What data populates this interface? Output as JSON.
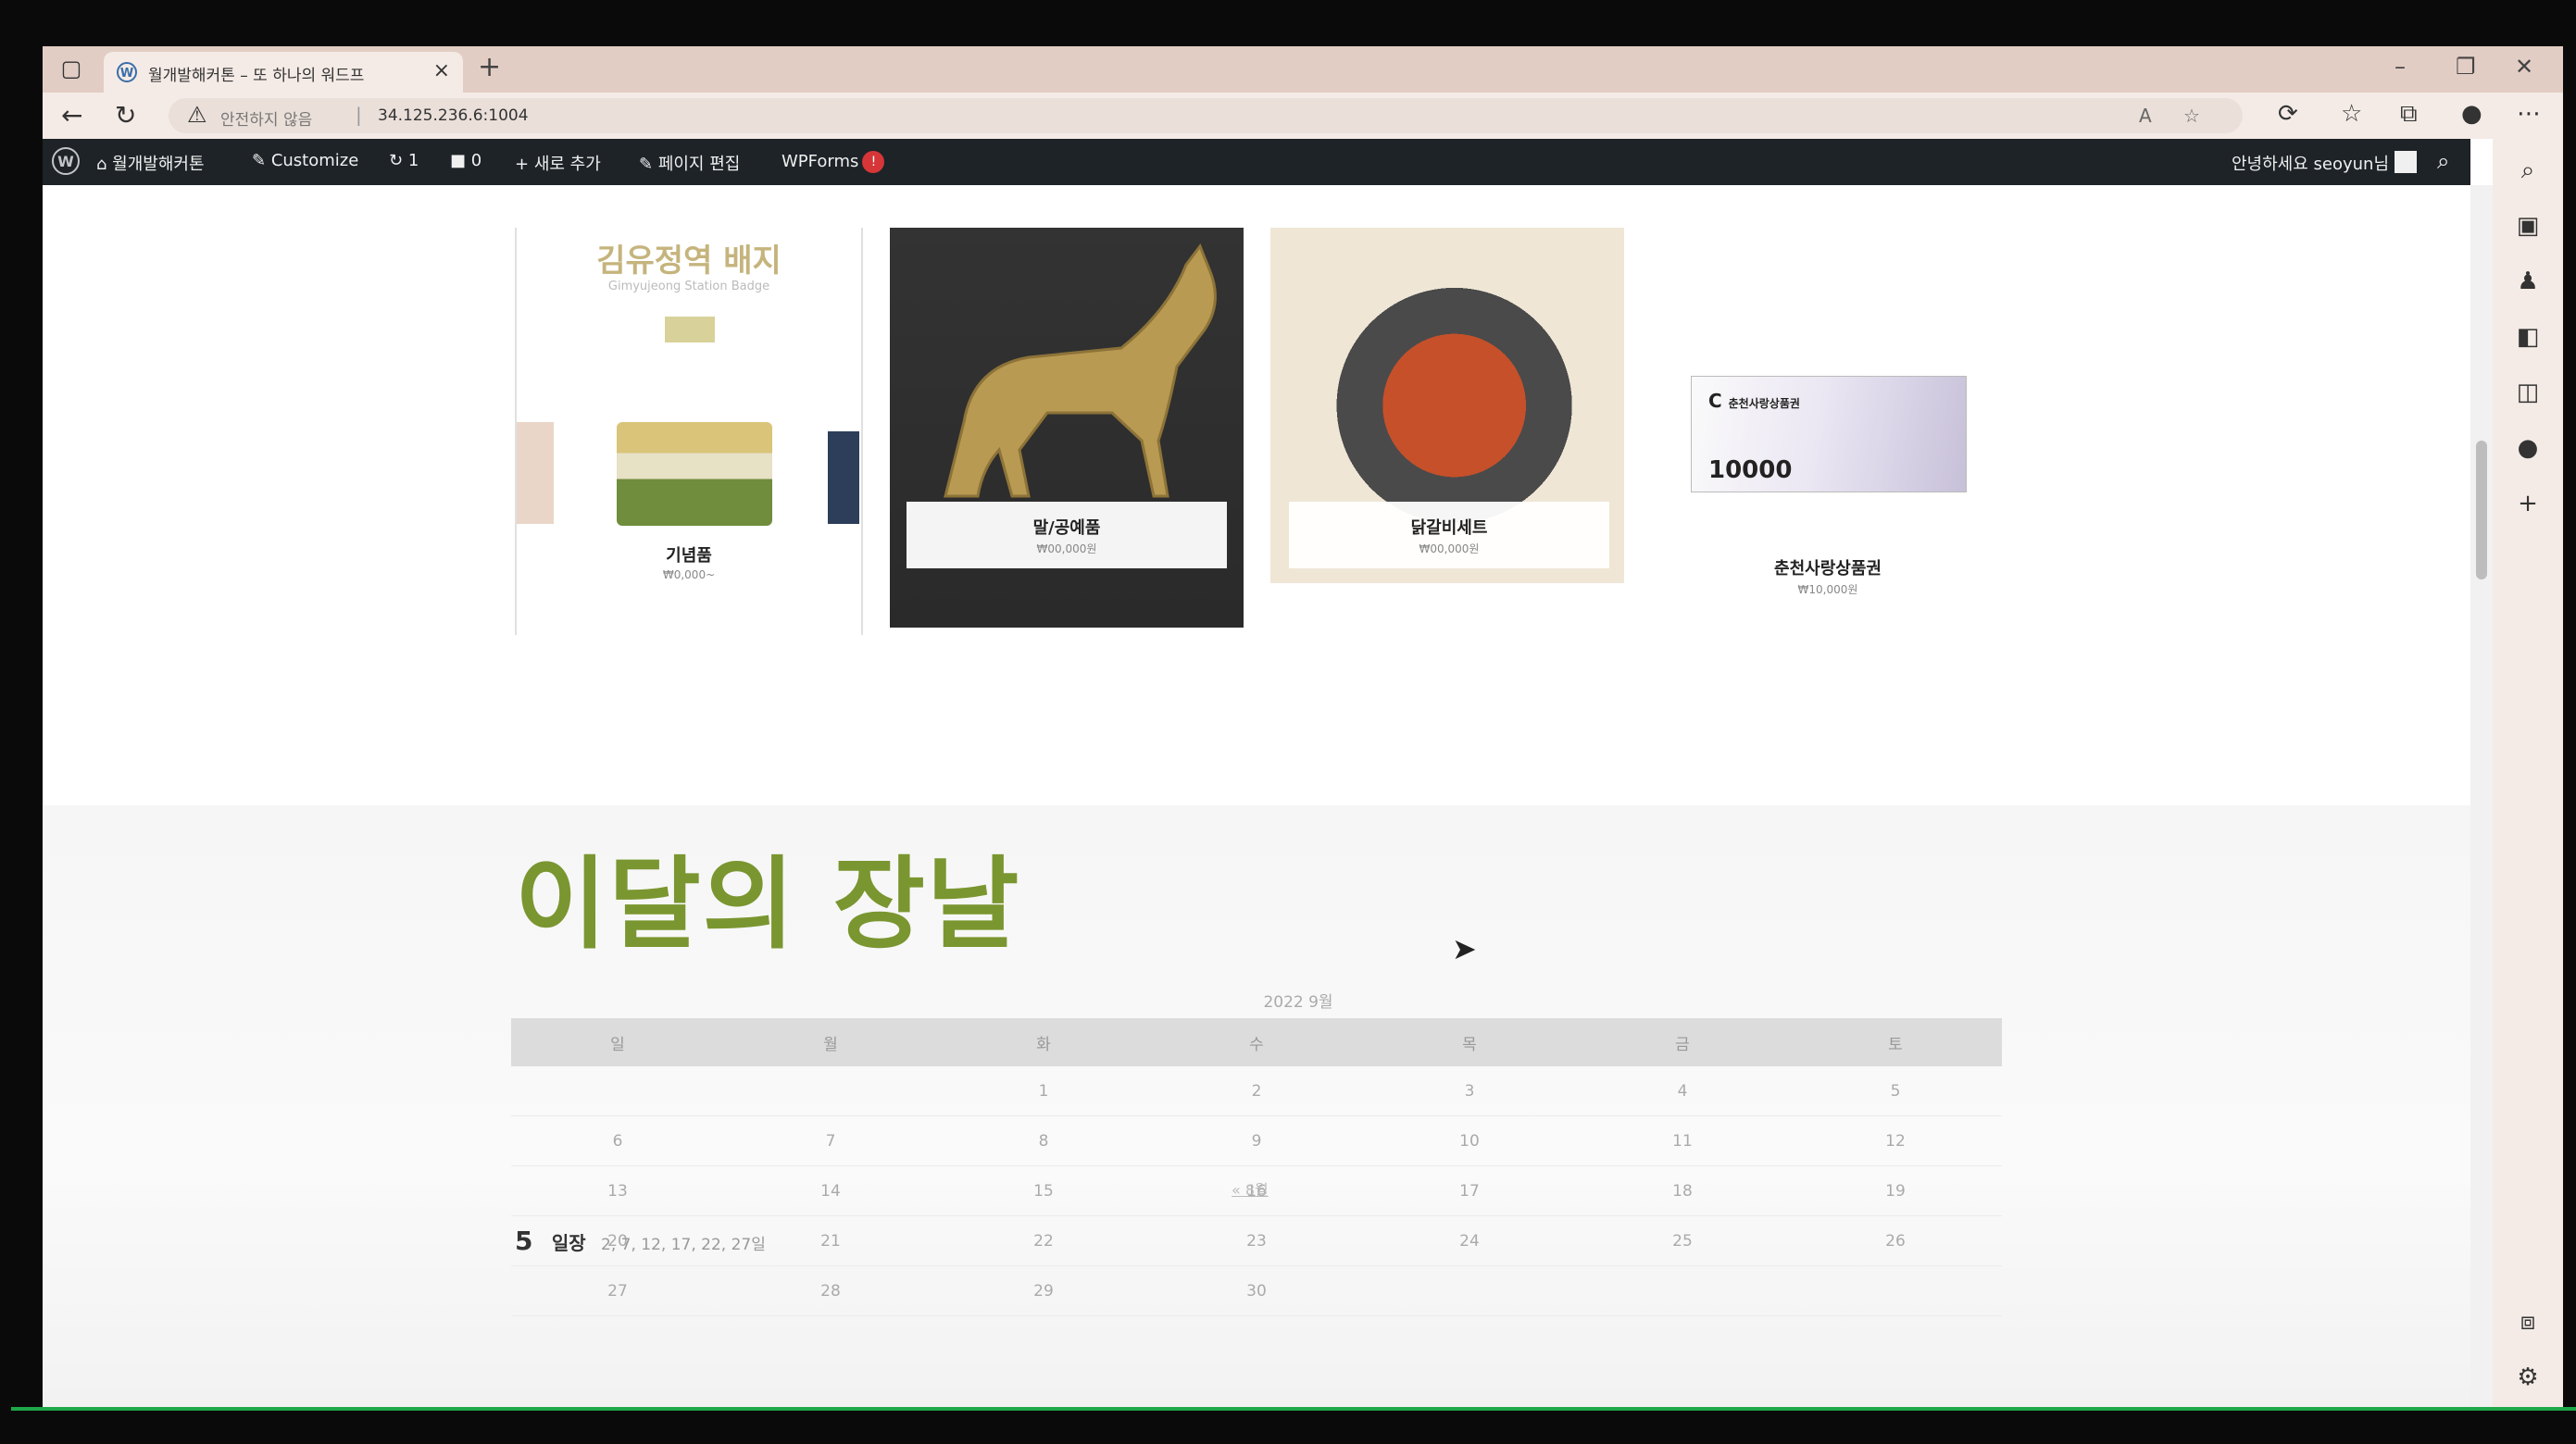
{
  "browser": {
    "tab_title": "월개발해커톤 – 또 하나의 워드프",
    "tab_close": "×",
    "new_tab": "+",
    "insecure_label": "안전하지 않음",
    "url": "34.125.236.6:1004",
    "min": "–",
    "restore": "❐",
    "close": "✕"
  },
  "adminbar": {
    "site_name": "월개발해커톤",
    "customize": "Customize",
    "updates_count": "1",
    "comments_count": "0",
    "new_label": "새로 추가",
    "edit_page": "페이지 편집",
    "wpforms": "WPForms",
    "wpforms_badge": "!",
    "greeting": "안녕하세요 seoyun님"
  },
  "products": {
    "p1_heading": "김유정역 배지",
    "p1_subheading": "Gimyujeong Station Badge",
    "p1_label": "기념품",
    "p1_price": "₩0,000~",
    "p2_label": "말/공예품",
    "p2_price": "₩00,000원",
    "p3_label": "닭갈비세트",
    "p3_price": "₩00,000원",
    "p4_brand": "춘천사랑상품권",
    "p4_value": "10000",
    "p4_label": "춘천사랑상품권",
    "p4_price": "₩10,000원"
  },
  "section": {
    "title": "이달의 장날",
    "calendar_caption": "2022 9월",
    "weekdays": [
      "일",
      "월",
      "화",
      "수",
      "목",
      "금",
      "토"
    ],
    "weeks": [
      [
        "",
        "",
        "1",
        "2",
        "3",
        "4",
        "5"
      ],
      [
        "6",
        "7",
        "8",
        "9",
        "10",
        "11",
        "12"
      ],
      [
        "13",
        "14",
        "15",
        "16",
        "17",
        "18",
        "19"
      ],
      [
        "20",
        "21",
        "22",
        "23",
        "24",
        "25",
        "26"
      ],
      [
        "27",
        "28",
        "29",
        "30",
        "",
        "",
        ""
      ]
    ],
    "prev_link": "« 8월",
    "event_number": "5",
    "event_label": "일장",
    "event_dates": "2, 7, 12, 17, 22, 27일"
  }
}
